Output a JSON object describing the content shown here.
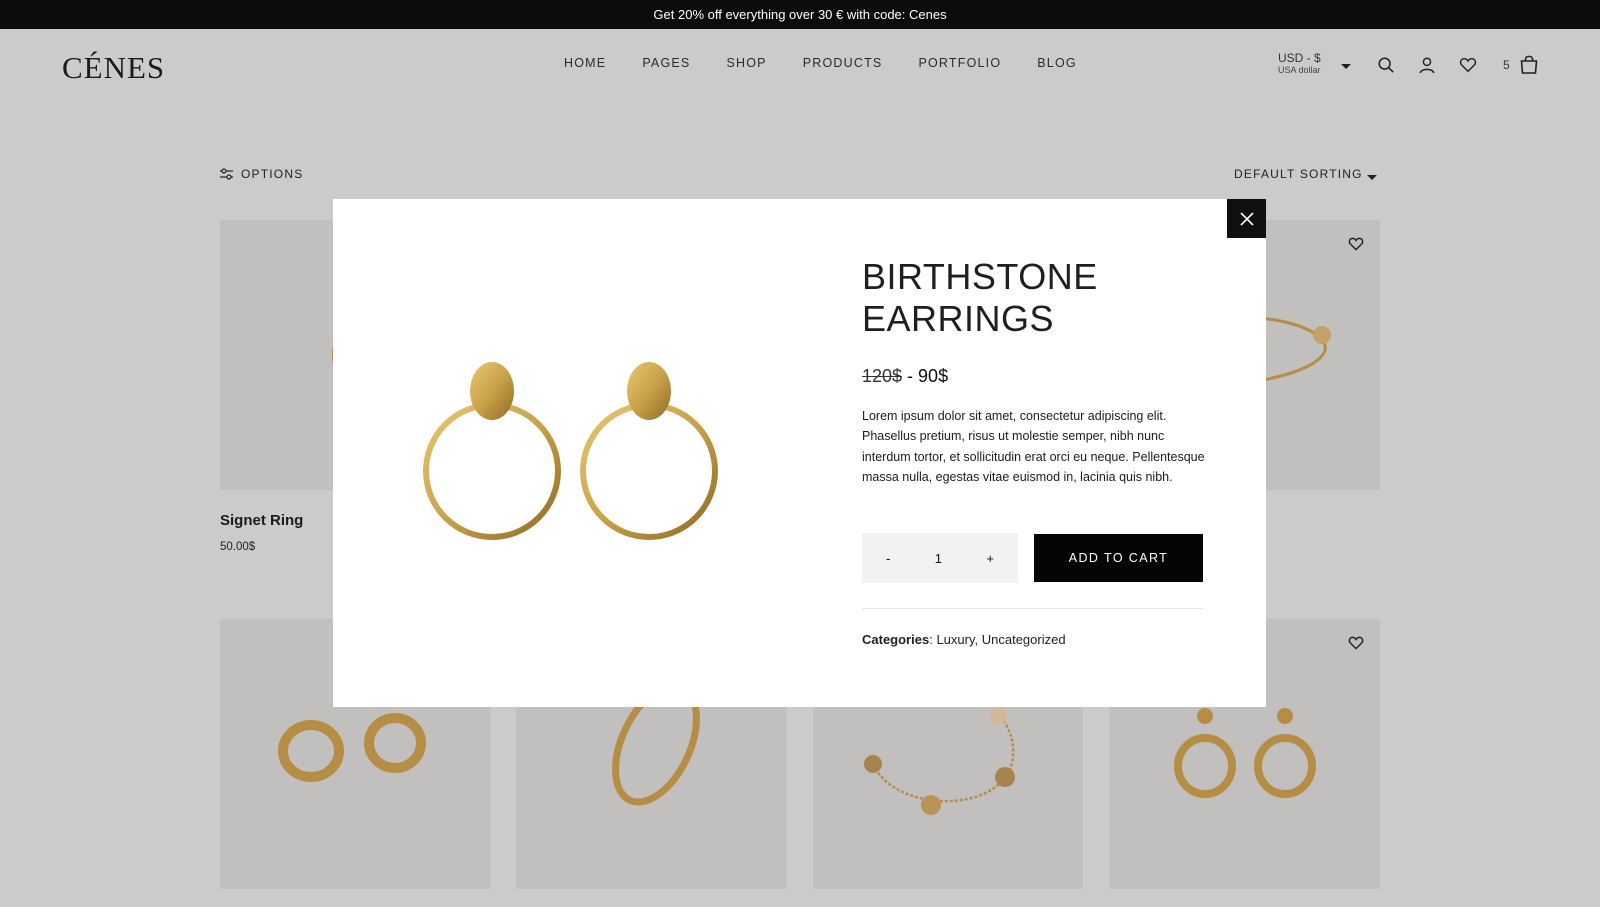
{
  "promo": {
    "text": "Get 20% off everything over 30 € with code: Cenes"
  },
  "header": {
    "logo": "CÉNES",
    "nav": [
      "HOME",
      "PAGES",
      "SHOP",
      "PRODUCTS",
      "PORTFOLIO",
      "BLOG"
    ],
    "currency": {
      "code": "USD - $",
      "name": "USA dollar"
    },
    "cart_count": "5",
    "icons": [
      "search-icon",
      "user-icon",
      "heart-icon",
      "bag-icon"
    ]
  },
  "toolbar": {
    "options_label": "OPTIONS",
    "sorting_label": "DEFAULT SORTING"
  },
  "grid": {
    "first_product": {
      "name": "Signet Ring",
      "price": "50.00$"
    }
  },
  "modal": {
    "title": "BIRTHSTONE EARRINGS",
    "old_price": "120$",
    "separator": " - ",
    "new_price": "90$",
    "description": "Lorem ipsum dolor sit amet, consectetur adipiscing elit. Phasellus pretium, risus ut molestie semper, nibh nunc interdum tortor, et sollicitudin erat orci eu neque. Pellentesque massa nulla, egestas vitae euismod in, lacinia quis nibh.",
    "qty_minus": "-",
    "qty_value": "1",
    "qty_plus": "+",
    "add_to_cart": "ADD TO CART",
    "categories_label": "Categories",
    "categories": [
      "Luxury",
      "Uncategorized"
    ]
  },
  "colors": {
    "background": "#cbcbcb",
    "tile": "#c1c0bf",
    "gold": "#c9a24a",
    "button": "#050505"
  }
}
